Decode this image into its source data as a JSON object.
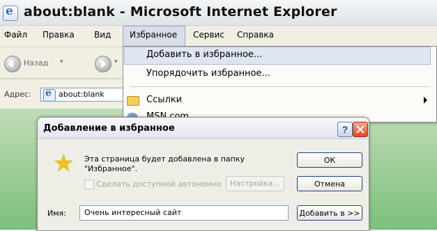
{
  "window": {
    "title": "about:blank - Microsoft Internet Explorer"
  },
  "menubar": {
    "items": [
      "Файл",
      "Правка",
      "Вид",
      "Избранное",
      "Сервис",
      "Справка"
    ]
  },
  "toolbar": {
    "back_label": "Назад"
  },
  "address": {
    "label": "Адрес:",
    "value": "about:blank"
  },
  "favorites_menu": {
    "items": [
      {
        "label": "Добавить в избранное..."
      },
      {
        "label": "Упорядочить избранное..."
      },
      {
        "label": "Ссылки"
      },
      {
        "label": "MSN.com"
      }
    ]
  },
  "dialog": {
    "title": "Добавление в избранное",
    "message_line1": "Эта страница будет добавлена в папку",
    "message_line2": "\"Избранное\".",
    "offline_checkbox_label": "Сделать доступной автономно",
    "settings_button": "Настройка...",
    "ok_button": "ОК",
    "cancel_button": "Отмена",
    "name_label": "Имя:",
    "name_value": "Очень интересный сайт",
    "add_to_button": "Добавить в >>",
    "help_label": "?"
  },
  "colors": {
    "close_button": "#d9482a",
    "highlight": "#dfe6f2",
    "star": "#f0c21e"
  }
}
